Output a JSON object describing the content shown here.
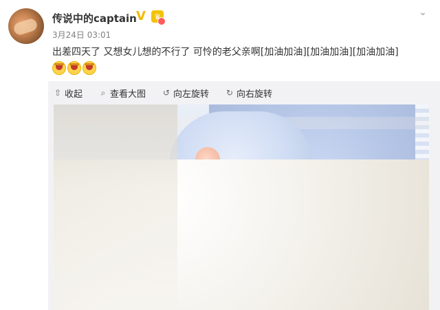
{
  "post": {
    "username": "传说中的captain",
    "timestamp": "3月24日 03:01",
    "text": "出差四天了 又想女儿想的不行了 可怜的老父亲啊[加油加油][加油加油][加油加油]",
    "emoji_count": 3
  },
  "badges": {
    "verified_mark": "V",
    "crown_mark": "♛"
  },
  "toolbar": {
    "collapse_label": "收起",
    "view_large_label": "查看大图",
    "rotate_left_label": "向左旋转",
    "rotate_right_label": "向右旋转"
  },
  "icons": {
    "more": "chevron-down-icon",
    "collapse": "collapse-icon",
    "view_large": "search-icon",
    "rotate_left": "rotate-left-icon",
    "rotate_right": "rotate-right-icon"
  },
  "colors": {
    "username": "#333333",
    "timestamp": "#808080",
    "panel_bg": "#f2f2f5",
    "verified": "#f2b800"
  }
}
